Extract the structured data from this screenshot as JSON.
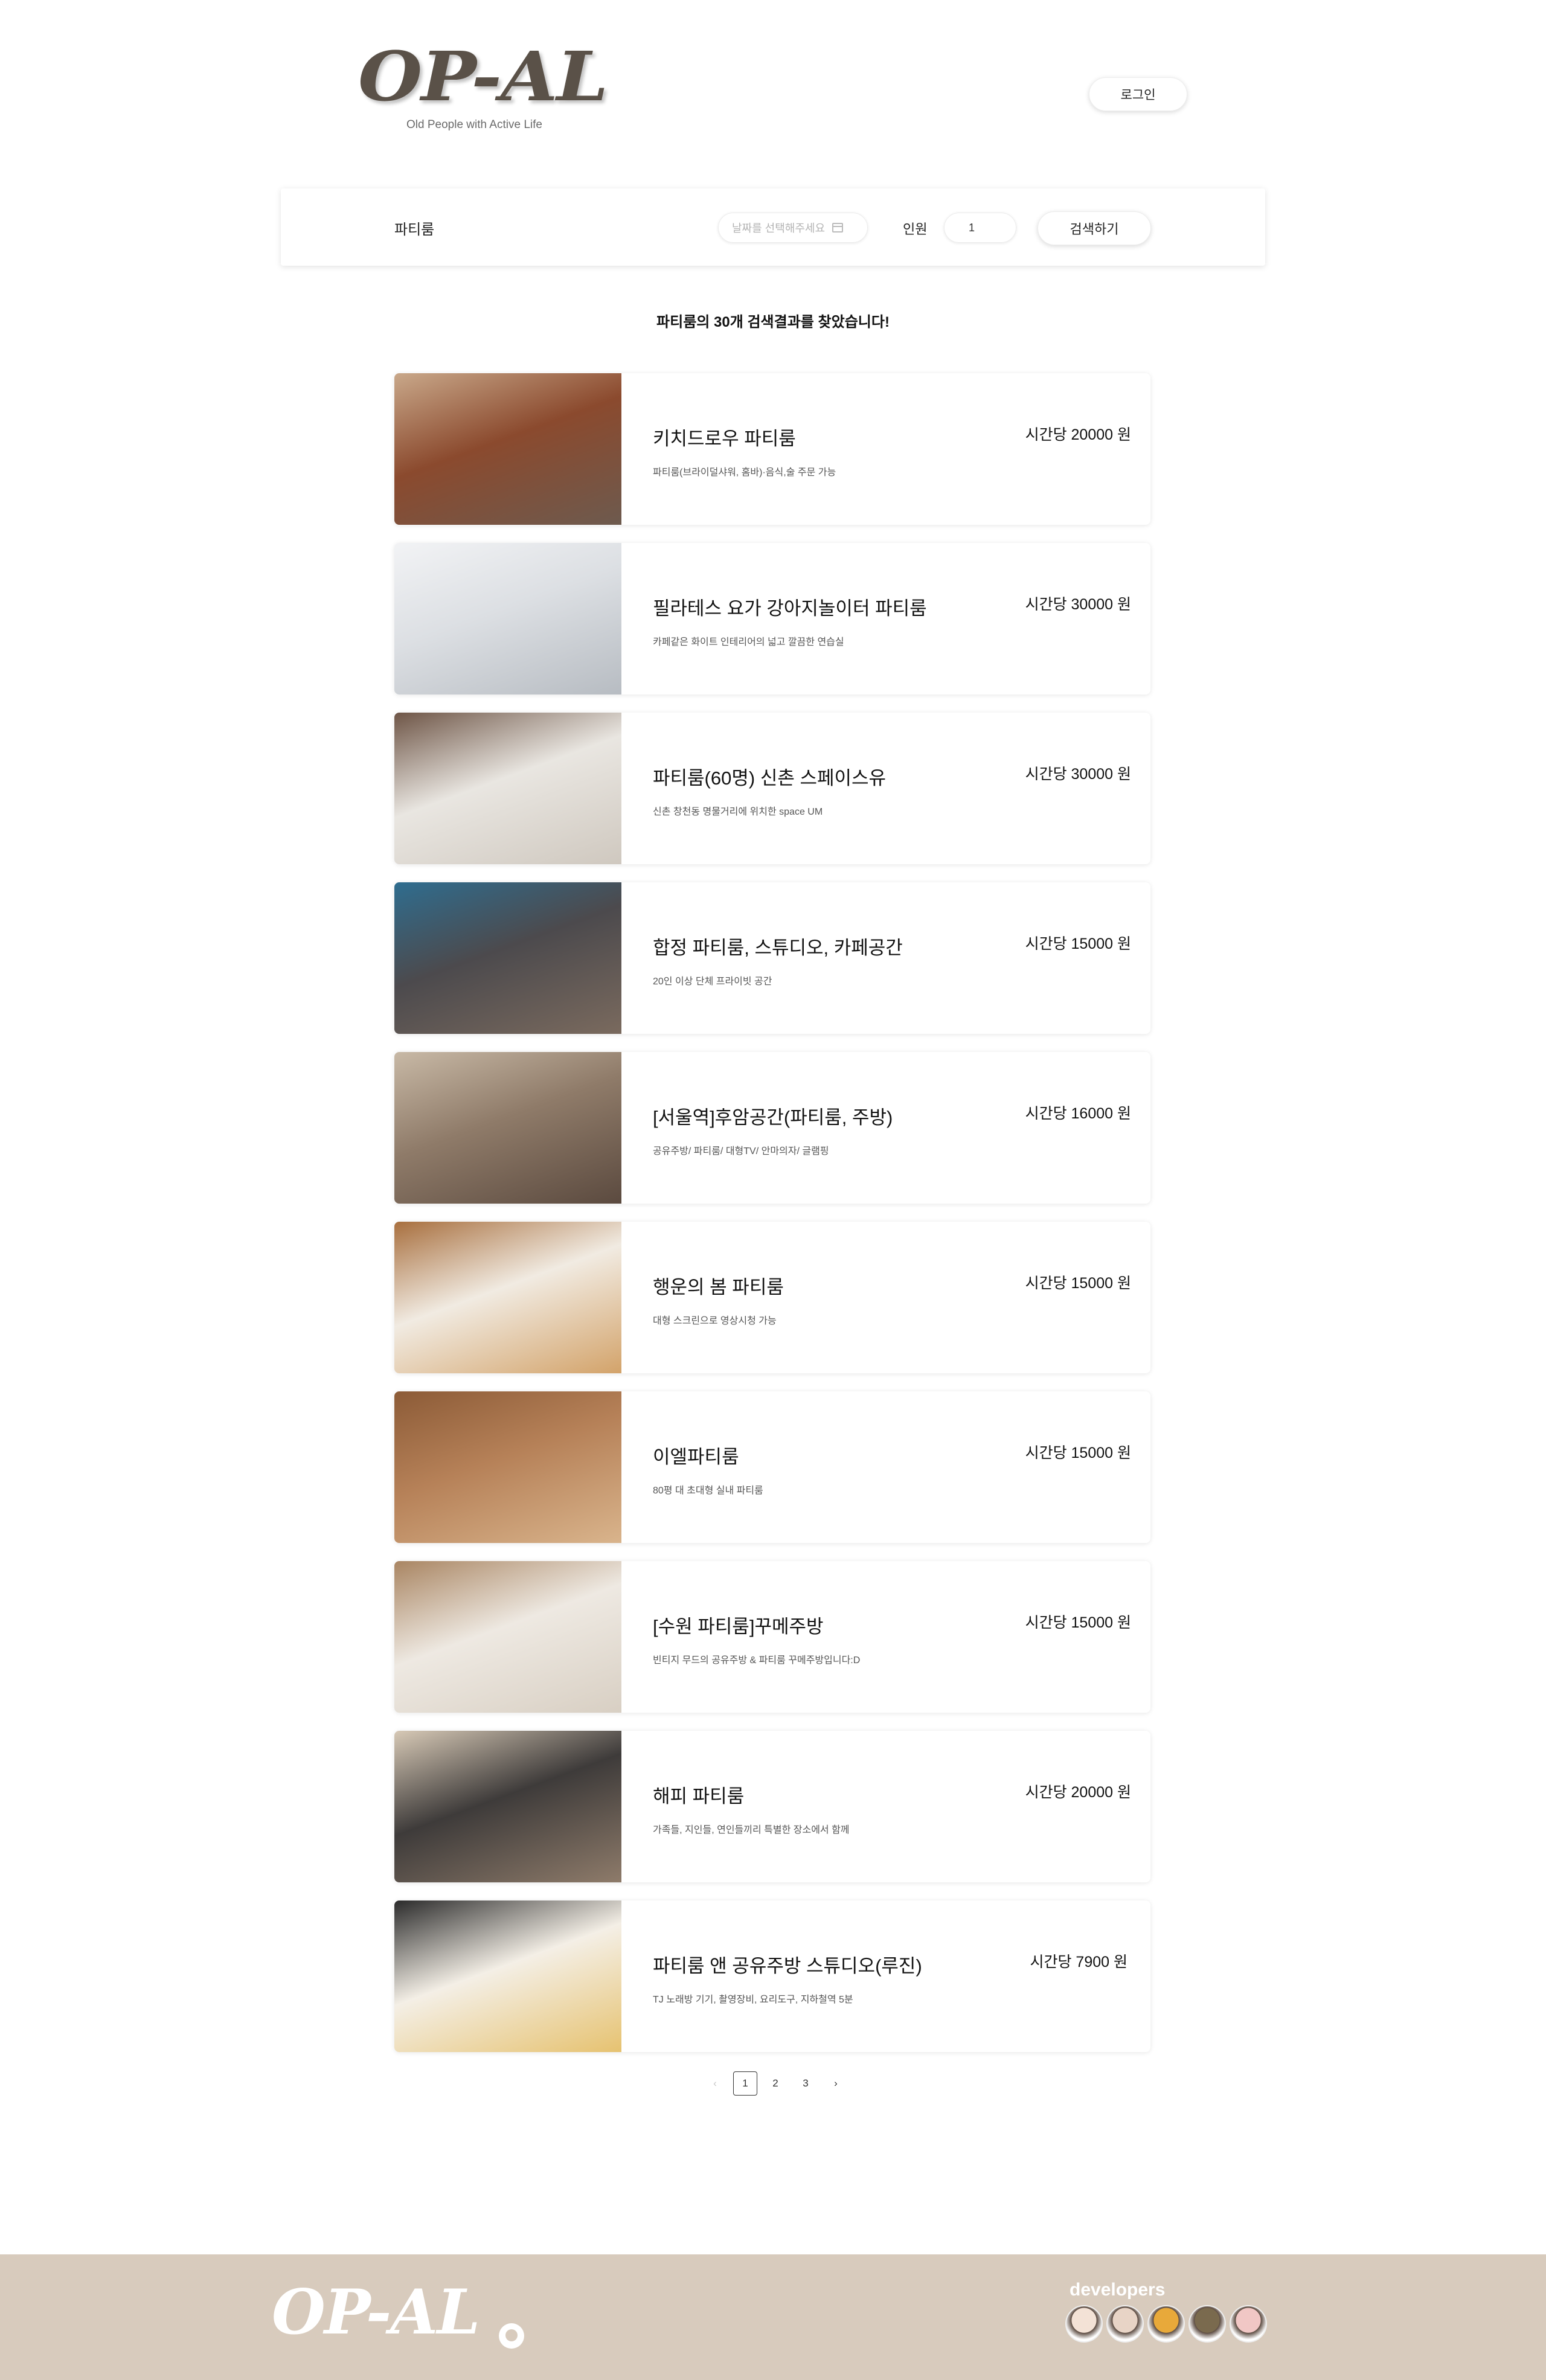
{
  "header": {
    "logo": "OP-AL",
    "tagline": "Old People with Active Life",
    "login_label": "로그인"
  },
  "search": {
    "category": "파티룸",
    "date_placeholder": "날짜를 선택해주세요",
    "people_label": "인원",
    "people_value": "1",
    "search_label": "검색하기"
  },
  "results": {
    "summary": "파티룸의 30개 검색결과를 찾았습니다!",
    "items": [
      {
        "title": "키치드로우 파티룸",
        "desc": "파티룸(브라이덜샤워, 홈바)·음식,술 주문 가능",
        "price": "시간당 20000 원",
        "colors": [
          "#8b4a2e",
          "#6d5a4e",
          "#c9a88a"
        ]
      },
      {
        "title": "필라테스 요가 강아지놀이터 파티룸",
        "desc": "카페같은 화이트 인테리어의 넓고 깔끔한 연습실",
        "price": "시간당 30000 원",
        "colors": [
          "#dcdfe3",
          "#b7bcc2",
          "#f2f3f5"
        ]
      },
      {
        "title": "파티룸(60명) 신촌 스페이스유",
        "desc": "신촌 창천동 명물거리에 위치한 space UM",
        "price": "시간당 30000 원",
        "colors": [
          "#e9e6e1",
          "#cfc8bf",
          "#6e5546"
        ]
      },
      {
        "title": "합정 파티룸, 스튜디오, 카페공간",
        "desc": "20인 이상 단체 프라이빗 공간",
        "price": "시간당 15000 원",
        "colors": [
          "#4c4a4d",
          "#7a6a5e",
          "#2f6d8f"
        ]
      },
      {
        "title": "[서울역]후암공간(파티룸, 주방)",
        "desc": "공유주방/ 파티룸/ 대형TV/ 안마의자/ 글램핑",
        "price": "시간당 16000 원",
        "colors": [
          "#8f7b69",
          "#5b4a3f",
          "#c8b9a6"
        ]
      },
      {
        "title": "행운의 봄 파티룸",
        "desc": "대형 스크린으로 영상시청 가능",
        "price": "시간당 15000 원",
        "colors": [
          "#f1ebe2",
          "#d3a36a",
          "#a86f3e"
        ]
      },
      {
        "title": "이엘파티룸",
        "desc": "80평 대 초대형 실내 파티룸",
        "price": "시간당 15000 원",
        "colors": [
          "#b68158",
          "#d9b48c",
          "#8c5b37"
        ]
      },
      {
        "title": "[수원 파티룸]꾸메주방",
        "desc": "빈티지 무드의 공유주방 & 파티룸 꾸메주방입니다:D",
        "price": "시간당 15000 원",
        "colors": [
          "#eee9e2",
          "#d8cfc3",
          "#a98562"
        ]
      },
      {
        "title": "해피 파티룸",
        "desc": "가족들, 지인들, 연인들끼리 특별한 장소에서 함께",
        "price": "시간당 20000 원",
        "colors": [
          "#3e3b3a",
          "#8e7b6a",
          "#d7c9b6"
        ]
      },
      {
        "title": "파티룸 앤 공유주방 스튜디오(루진)",
        "desc": "TJ 노래방 기기, 촬영장비, 요리도구, 지하철역 5분",
        "price": "시간당 7900 원",
        "colors": [
          "#f4efe6",
          "#e6c270",
          "#2b2b2b"
        ]
      }
    ]
  },
  "pagination": {
    "prev": "‹",
    "pages": [
      "1",
      "2",
      "3"
    ],
    "next": "›",
    "current": "1"
  },
  "footer": {
    "logo": "OP-AL",
    "developers_label": "developers",
    "avatar_colors": [
      "#f3e2d6",
      "#e8d4c6",
      "#e8a93a",
      "#7a6a4e",
      "#f1c7c5"
    ]
  }
}
